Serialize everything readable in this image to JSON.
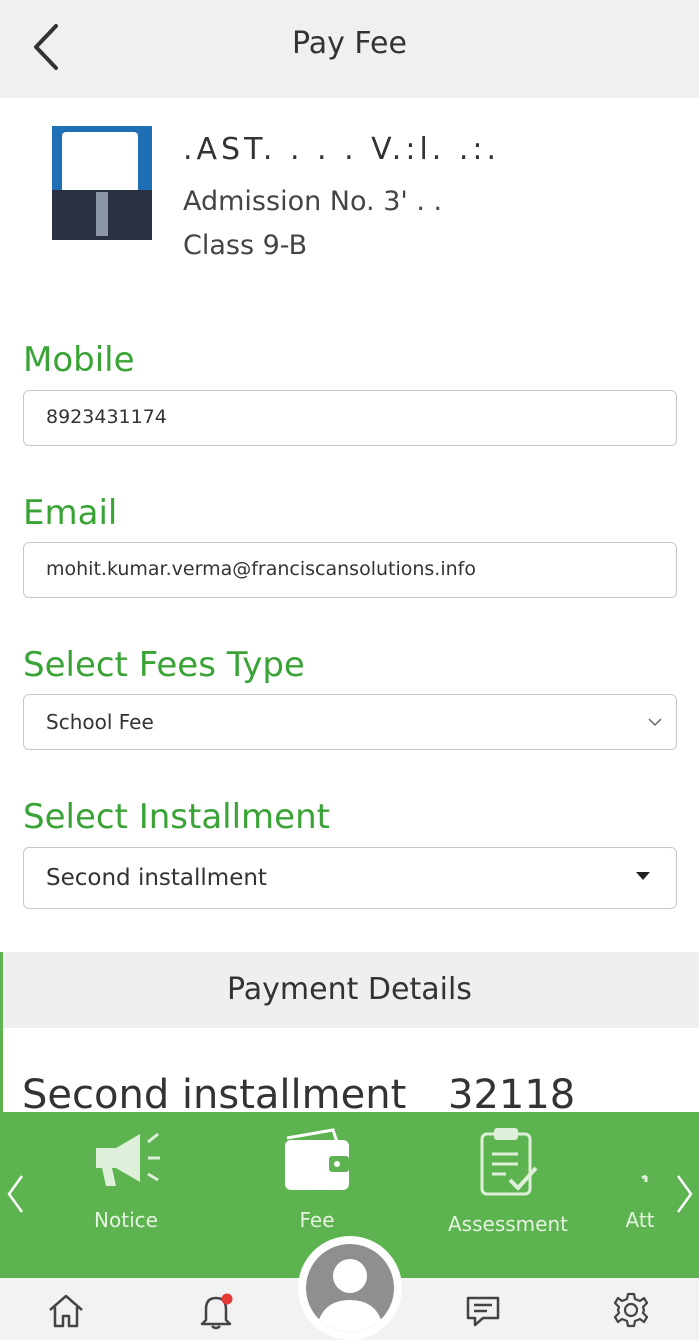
{
  "header": {
    "title": "Pay Fee"
  },
  "student": {
    "name": ".AST. . . . V.:l. .:.",
    "admission": "Admission No. 3'  . .",
    "class": "Class 9-B"
  },
  "form": {
    "mobile": {
      "label": "Mobile",
      "value": "8923431174"
    },
    "email": {
      "label": "Email",
      "value": "mohit.kumar.verma@franciscansolutions.info"
    },
    "fees_type": {
      "label": "Select Fees Type",
      "value": "School Fee"
    },
    "installment": {
      "label": "Select Installment",
      "value": "Second installment"
    }
  },
  "payment": {
    "title": "Payment Details",
    "row_label": "Second installment",
    "row_amount": "32118"
  },
  "modules": [
    {
      "label": "Notice",
      "icon": "megaphone-icon"
    },
    {
      "label": "Fee",
      "icon": "wallet-icon"
    },
    {
      "label": "Assessment",
      "icon": "clipboard-check-icon"
    },
    {
      "label": "Att",
      "icon": "attendance-icon"
    }
  ],
  "bottom_nav": [
    "home-icon",
    "bell-icon",
    "profile-icon",
    "chat-icon",
    "settings-icon"
  ],
  "colors": {
    "accent": "#3aa336",
    "module_bar": "#5cb34f",
    "header_bg": "#f0f0f0",
    "notification_dot": "#e53935"
  }
}
